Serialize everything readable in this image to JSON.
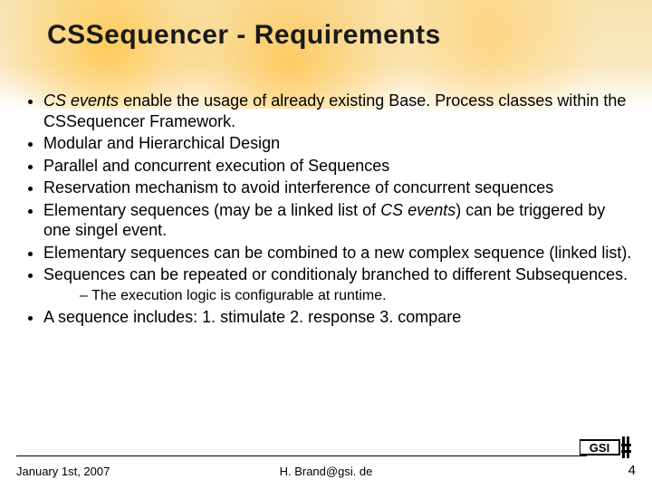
{
  "title": "CSSequencer - Requirements",
  "bullets": [
    {
      "html": "<span class='it'>CS events</span> <span class='plain'>enable the usage of already existing Base. Process classes within the CSSequencer Framework.</span>"
    },
    {
      "html": "<span class='plain'>Modular and Hierarchical Design</span>"
    },
    {
      "html": "<span class='plain'>Parallel and concurrent execution of Sequences</span>"
    },
    {
      "html": "<span class='plain'>Reservation mechanism to avoid interference of concurrent sequences</span>"
    },
    {
      "html": "<span class='plain'>Elementary sequences (may be a linked list of </span><span class='it'>CS events</span><span class='plain'>) can be triggered by one singel event.</span>"
    },
    {
      "html": "<span class='plain'>Elementary sequences can be combined to a new complex sequence (linked list).</span>"
    },
    {
      "html": "<span class='plain'>Sequences can be repeated or conditionaly branched to different Subsequences.</span>"
    }
  ],
  "sub_bullet": "The execution logic is configurable at runtime.",
  "last_bullet": "A sequence includes: 1. stimulate 2. response 3. compare",
  "footer": {
    "date": "January 1st, 2007",
    "email": "H. Brand@gsi. de",
    "page": "4"
  },
  "logo_text": "GSI"
}
